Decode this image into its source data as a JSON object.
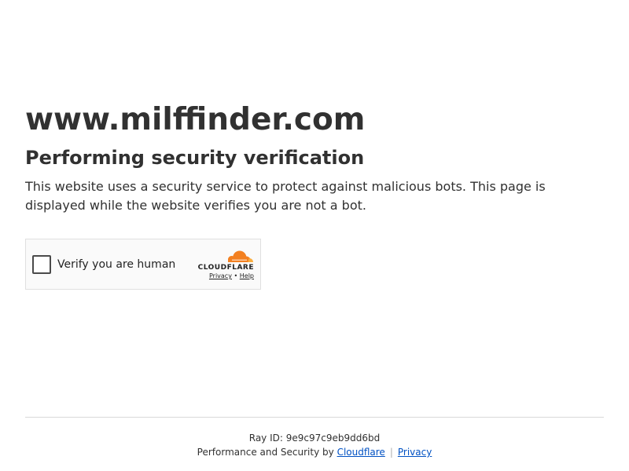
{
  "site": {
    "name": "www.milffinder.com"
  },
  "content": {
    "heading": "Performing security verification",
    "description": "This website uses a security service to protect against malicious bots. This page is displayed while the website verifies you are not a bot."
  },
  "widget": {
    "label": "Verify you are human",
    "brand": "CLOUDFLARE",
    "privacy_link": "Privacy",
    "link_separator": "•",
    "help_link": "Help",
    "brand_color": "#f38020"
  },
  "footer": {
    "ray_label": "Ray ID:",
    "ray_id": "9e9c97c9eb9dd6bd",
    "perf_text": "Performance and Security by",
    "cloudflare_link": "Cloudflare",
    "separator": "|",
    "privacy_link": "Privacy"
  }
}
